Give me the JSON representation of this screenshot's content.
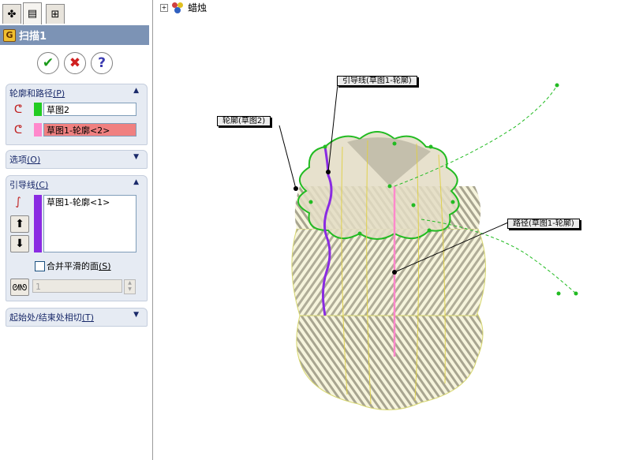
{
  "tree": {
    "expander": "+",
    "part_name": "蜡烛"
  },
  "panel": {
    "title": "扫描1",
    "tabs": [
      "feature-manager-icon",
      "property-manager-icon",
      "configuration-manager-icon"
    ],
    "buttons": {
      "ok": "✔",
      "cancel": "✖",
      "help": "?"
    },
    "profile_path": {
      "header": "轮廓和路径",
      "header_key": "(P)",
      "profile": "草图2",
      "path": "草图1-轮廓<2>",
      "profile_color": "#22cc22",
      "path_color": "#ff88cc",
      "path_field_bg": "#f08080"
    },
    "options": {
      "header": "选项",
      "header_key": "(O)"
    },
    "guide_curves": {
      "header": "引导线",
      "header_key": "(C)",
      "items": [
        "草图1-轮廓<1>"
      ],
      "color": "#8a2be2",
      "merge_label": "合并平滑的面",
      "merge_key": "(S)",
      "merge_checked": false,
      "spinner_value": "1"
    },
    "tangency": {
      "header": "起始处/结束处相切",
      "header_key": "(T)"
    }
  },
  "callouts": {
    "profile": "轮廓(草图2)",
    "guide": "引导线(草图1-轮廓)",
    "path": "路径(草图1-轮廓)"
  }
}
